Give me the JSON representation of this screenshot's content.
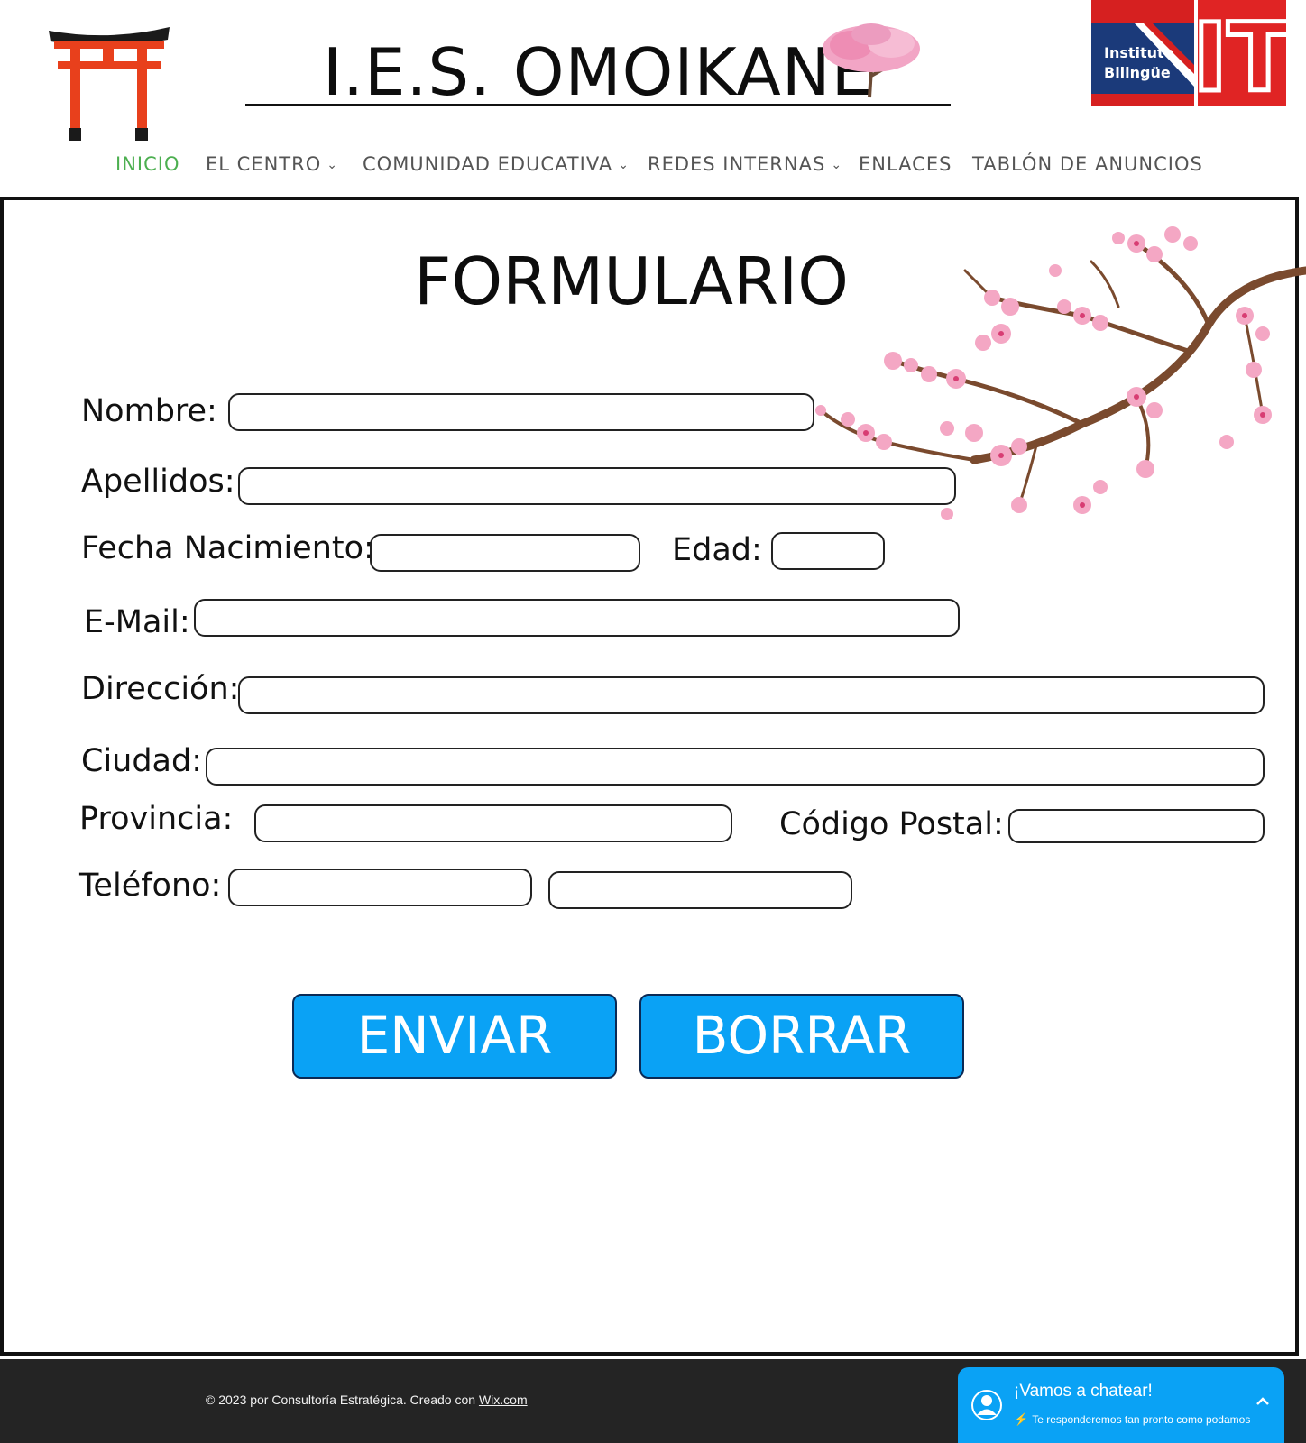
{
  "header": {
    "school_name": "I.E.S. OMOIKANE",
    "bilingual_logo": {
      "line1": "Instituto",
      "line2": "Bilingüe",
      "mark": "IT"
    }
  },
  "nav": {
    "items": [
      {
        "label": "INICIO",
        "active": true,
        "dropdown": false
      },
      {
        "label": "EL CENTRO",
        "dropdown": true
      },
      {
        "label": "COMUNIDAD EDUCATIVA",
        "dropdown": true
      },
      {
        "label": "REDES INTERNAS",
        "dropdown": true
      },
      {
        "label": "ENLACES",
        "dropdown": false
      },
      {
        "label": "TABLÓN DE ANUNCIOS",
        "dropdown": false
      }
    ],
    "chevron": "⌄",
    "active_color": "#4caf50"
  },
  "form": {
    "title": "FORMULARIO",
    "labels": {
      "nombre": "Nombre:",
      "apellidos": "Apellidos:",
      "fecha_nacimiento": "Fecha Nacimiento:",
      "edad": "Edad:",
      "email": "E-Mail:",
      "direccion": "Dirección:",
      "ciudad": "Ciudad:",
      "provincia": "Provincia:",
      "codigo_postal": "Código Postal:",
      "telefono": "Teléfono:"
    },
    "values": {
      "nombre": "",
      "apellidos": "",
      "fecha_nacimiento": "",
      "edad": "",
      "email": "",
      "direccion": "",
      "ciudad": "",
      "provincia": "",
      "codigo_postal": "",
      "telefono_1": "",
      "telefono_2": ""
    },
    "buttons": {
      "submit": "ENVIAR",
      "reset": "BORRAR"
    },
    "button_color": "#0aa2f5"
  },
  "footer": {
    "copyright": "© 2023 por Consultoría Estratégica. Creado con ",
    "link": "Wix.com"
  },
  "chat": {
    "title": "¡Vamos a chatear!",
    "subtitle": "Te responderemos tan pronto como podamos",
    "bolt_icon": "⚡"
  }
}
